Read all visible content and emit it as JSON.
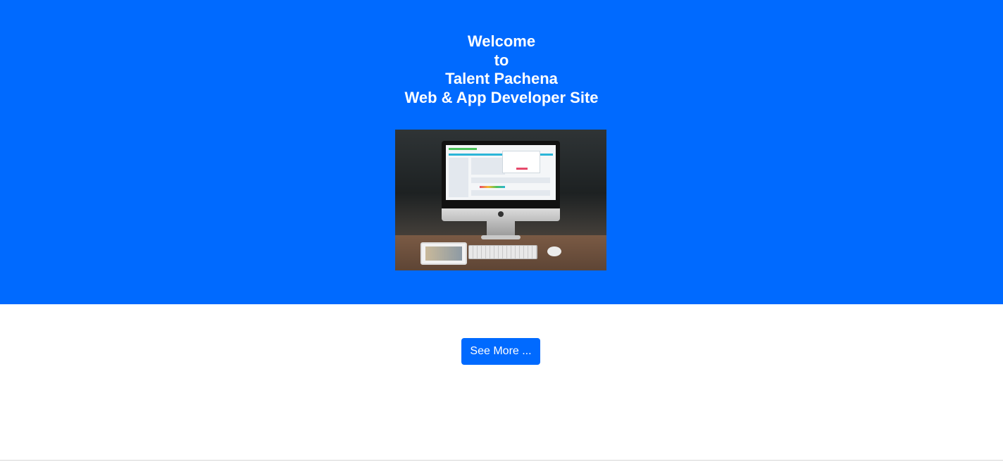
{
  "hero": {
    "background_color": "#006aff",
    "title_lines": [
      "Welcome",
      "to",
      "Talent Pachena",
      "Web & App Developer Site"
    ],
    "image": {
      "description_icon": "imac-desk-photo"
    }
  },
  "actions": {
    "see_more_label": "See More ...",
    "button_color": "#006aff"
  }
}
